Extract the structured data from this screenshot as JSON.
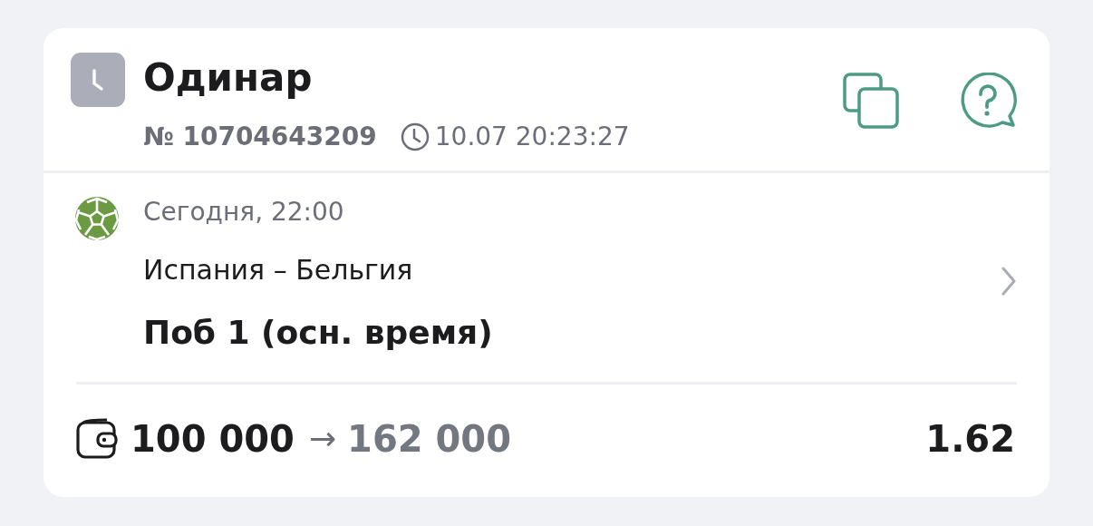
{
  "bet": {
    "status_icon": {
      "kind": "pending"
    },
    "type": "Одинар",
    "number": "№ 10704643209",
    "placed_at": "10.07 20:23:27"
  },
  "event": {
    "sport_icon": {
      "kind": "football"
    },
    "start": "Сегодня, 22:00",
    "teams": "Испания – Бельгия",
    "market": "Поб 1 (осн. время)"
  },
  "footer": {
    "stake": "100 000",
    "arrow": "→",
    "payout": "162 000",
    "odds": "1.62"
  }
}
